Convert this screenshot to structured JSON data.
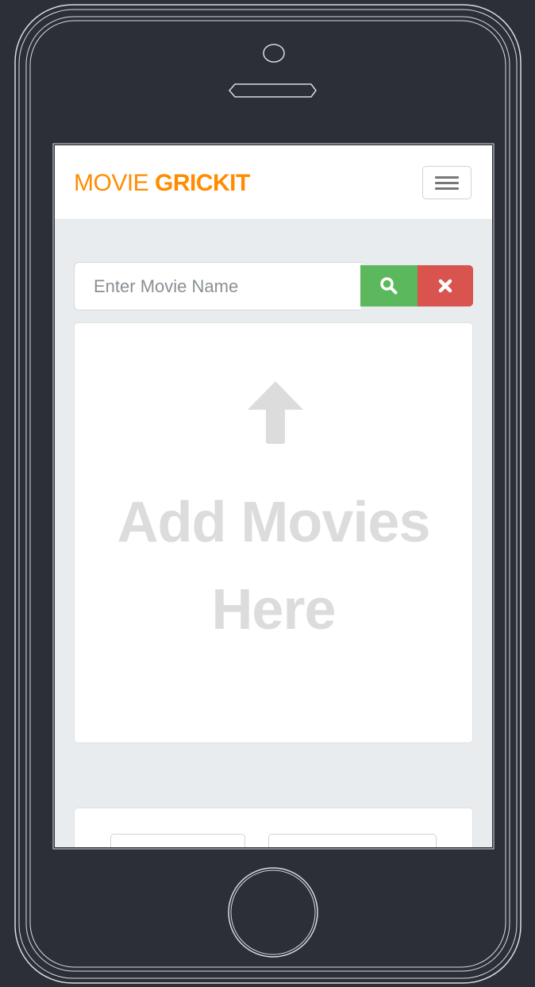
{
  "navbar": {
    "brand_part1": "MOVIE ",
    "brand_part2": "GRICKIT",
    "brand_color": "#ff8c00",
    "menu_icon": "hamburger-menu-icon"
  },
  "search": {
    "placeholder": "Enter Movie Name",
    "value": "",
    "search_icon": "search-icon",
    "search_color": "#5cb85c",
    "clear_icon": "close-icon",
    "clear_color": "#d9534f"
  },
  "dropzone": {
    "icon": "arrow-up-icon",
    "line1": "Add Movies",
    "line2": "Here"
  }
}
